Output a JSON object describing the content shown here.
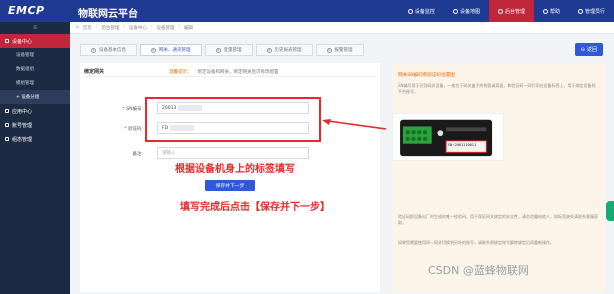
{
  "app": {
    "logo": "EMCP",
    "subtitle": "物联网云平台"
  },
  "top_nav": [
    {
      "label": "设备监控",
      "active": false
    },
    {
      "label": "设备地图",
      "active": false
    },
    {
      "label": "后台管理",
      "active": true
    },
    {
      "label": "帮助",
      "active": false
    },
    {
      "label": "管理员行",
      "active": false
    }
  ],
  "sidebar": {
    "collapse_glyph": "≡",
    "groups": [
      {
        "label": "设备中心",
        "open": true
      },
      {
        "label": "应用中心"
      },
      {
        "label": "账号管理"
      },
      {
        "label": "组态管理"
      }
    ],
    "sub_items": [
      {
        "label": "设备管理"
      },
      {
        "label": "数据组组"
      },
      {
        "label": "模组管理"
      },
      {
        "label": "+ 设备分组",
        "active": true
      }
    ]
  },
  "breadcrumb": [
    "首页",
    "后台管理",
    "设备中心",
    "设备管理",
    "编辑"
  ],
  "steps": [
    {
      "num": "1",
      "label": "设备基本信息",
      "active": false
    },
    {
      "num": "2",
      "label": "网关、通讯管理",
      "active": true
    },
    {
      "num": "3",
      "label": "变量管理",
      "active": false
    },
    {
      "num": "4",
      "label": "历史报表管理",
      "active": false
    },
    {
      "num": "5",
      "label": "报警管理",
      "active": false
    }
  ],
  "return_button": "返回",
  "form": {
    "title": "绑定网关",
    "tip_label": "温馨提示：",
    "tip_text": "绑定设备和网关，绑定网关后可修改配置",
    "sn_label": "SN编号:",
    "sn_value": "20013",
    "code_label": "验证码:",
    "code_value": "FD",
    "remark_label": "备注:",
    "remark_placeholder": "请输入",
    "save_button": "保存并下一步"
  },
  "annotations": {
    "fill_hint": "根据设备机身上的标签填写",
    "click_hint": "填写完成后点击【保存并下一步】"
  },
  "info": {
    "title": "网关SN编码和验证码位置图",
    "text1": "SN编号用于识别网关设备，一般位于网关盒子的侧面或背面，和验证码一同打印在设备标签上，用于绑定设备到平台账号。",
    "text2": "验证码即设备出厂时生成的唯一校验码，用于保证网关绑定的安全性，请勿泄露给他人，如标签缺失请联系客服获取。",
    "text3": "如果您需要使用同一网关切换到另外的账号，请联系原绑定账号解除绑定后再重新操作。",
    "device_label": "SN:2001110011"
  },
  "watermark": "CSDN @蓝蜂物联网",
  "colors": {
    "topbar": "#1f3a93",
    "accent_red": "#c2263b",
    "primary_blue": "#2f59d6",
    "sidebar": "#1d2a44",
    "annotation_red": "#e62a2a"
  }
}
